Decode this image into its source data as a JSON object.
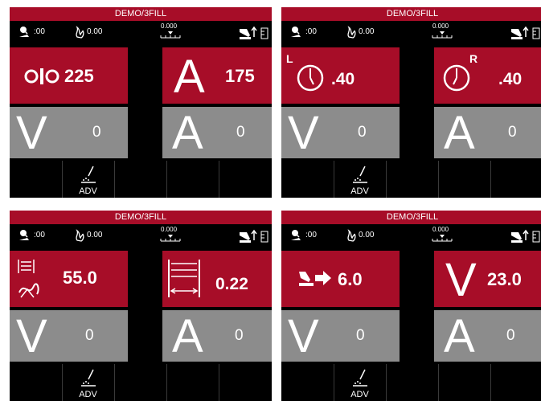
{
  "panels": [
    {
      "title": "DEMO/3FILL",
      "status": {
        "timer": ":00",
        "heat": "0.00",
        "scale": "0.000"
      },
      "top_left": {
        "icon": "wire-feed-rolls-icon",
        "value": "225"
      },
      "top_right": {
        "icon": "amps-letter",
        "letter": "A",
        "value": "175"
      },
      "bottom_left": {
        "letter": "V",
        "value": "0"
      },
      "bottom_right": {
        "letter": "A",
        "value": "0"
      },
      "softkeys": [
        "",
        "ADV",
        "",
        "",
        ""
      ]
    },
    {
      "title": "DEMO/3FILL",
      "status": {
        "timer": ":00",
        "heat": "0.00",
        "scale": "0.000"
      },
      "top_left": {
        "icon": "start-timer-icon",
        "label": "L",
        "value": ".40"
      },
      "top_right": {
        "icon": "stop-timer-icon",
        "label": "R",
        "value": ".40"
      },
      "bottom_left": {
        "letter": "V",
        "value": "0"
      },
      "bottom_right": {
        "letter": "A",
        "value": "0"
      },
      "softkeys": [
        "",
        "ADV",
        "",
        "",
        ""
      ]
    },
    {
      "title": "DEMO/3FILL",
      "status": {
        "timer": ":00",
        "heat": "0.00",
        "scale": "0.000"
      },
      "top_left": {
        "icon": "oscillation-width-icon",
        "value": "55.0"
      },
      "top_right": {
        "icon": "weave-width-icon",
        "value": "0.22"
      },
      "bottom_left": {
        "letter": "V",
        "value": "0"
      },
      "bottom_right": {
        "letter": "A",
        "value": "0"
      },
      "softkeys": [
        "",
        "ADV",
        "",
        "",
        ""
      ]
    },
    {
      "title": "DEMO/3FILL",
      "status": {
        "timer": ":00",
        "heat": "0.00",
        "scale": "0.000"
      },
      "top_left": {
        "icon": "travel-speed-icon",
        "value": "6.0"
      },
      "top_right": {
        "icon": "volts-letter",
        "letter": "V",
        "value": "23.0"
      },
      "bottom_left": {
        "letter": "V",
        "value": "0"
      },
      "bottom_right": {
        "letter": "A",
        "value": "0"
      },
      "softkeys": [
        "",
        "ADV",
        "",
        "",
        ""
      ]
    }
  ],
  "colors": {
    "accent_red": "#a70d28",
    "grey_tile": "#8c8c8c",
    "background": "#000000"
  }
}
